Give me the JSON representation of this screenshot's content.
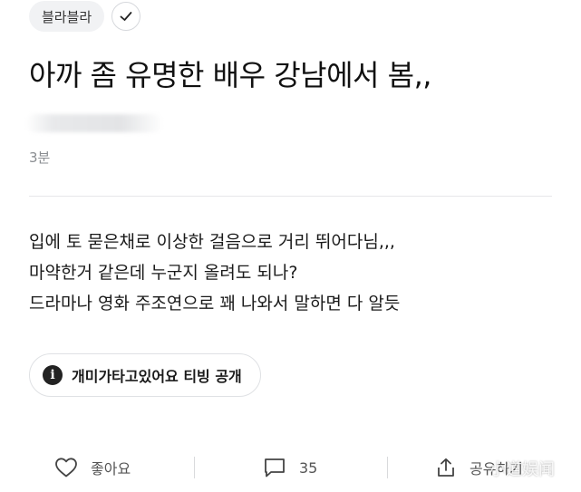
{
  "topic": {
    "label": "블라블라"
  },
  "post": {
    "title": "아까 좀 유명한 배우 강남에서 봄,,",
    "time": "3분",
    "body_lines": [
      "입에 토 묻은채로 이상한 걸음으로 거리 뛰어다님,,,",
      "마약한거 같은데 누군지 올려도 되나?",
      "드라마나 영화 주조연으로 꽤 나와서 말하면 다 알듯"
    ]
  },
  "tag": {
    "label": "개미가타고있어요 티빙 공개",
    "icon": "info-icon"
  },
  "actions": {
    "like_label": "좋아요",
    "comment_count": "35",
    "share_label": "공유하기"
  },
  "watermark": {
    "text": "小道娱闻"
  },
  "colors": {
    "chip_bg": "#f1f2f4",
    "text_primary": "#111111",
    "text_secondary": "#8a8d91",
    "divider": "#e6e7e9"
  }
}
